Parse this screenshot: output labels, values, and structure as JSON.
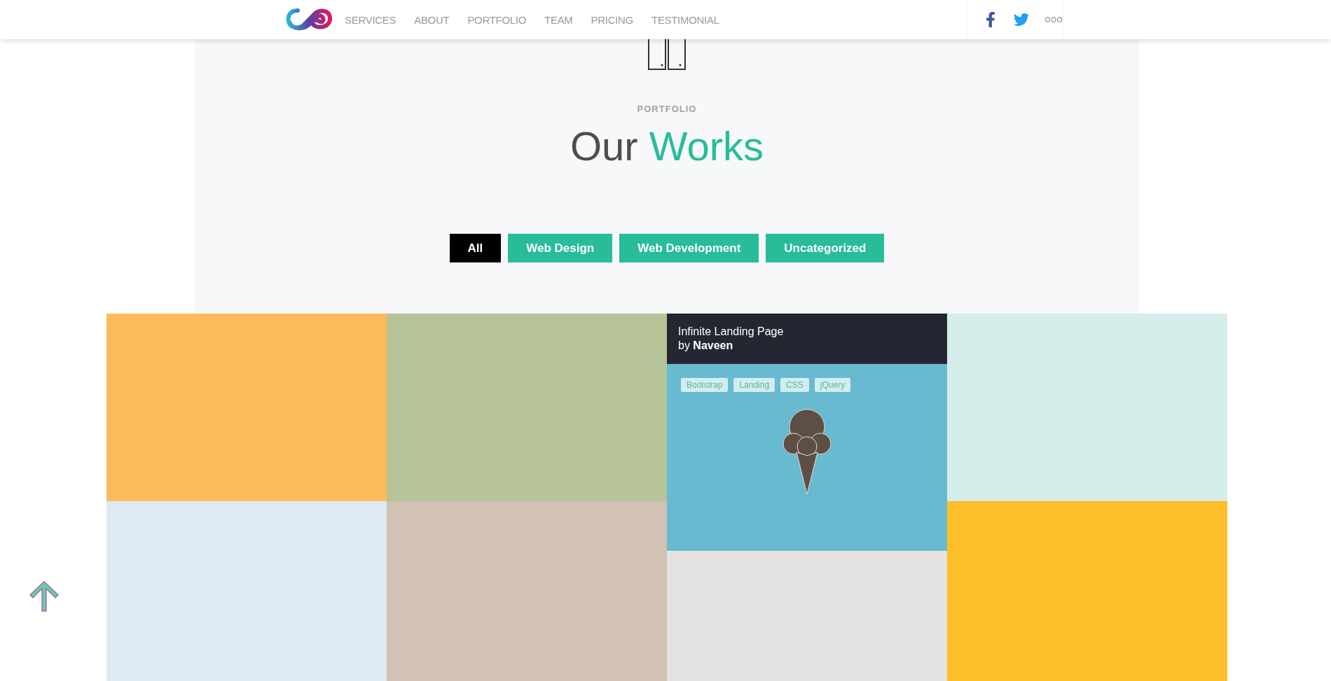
{
  "nav": {
    "items": [
      {
        "label": "SERVICES"
      },
      {
        "label": "ABOUT"
      },
      {
        "label": "PORTFOLIO"
      },
      {
        "label": "TEAM"
      },
      {
        "label": "PRICING"
      },
      {
        "label": "TESTIMONIAL"
      }
    ]
  },
  "section": {
    "eyebrow": "PORTFOLIO",
    "title_main": "Our",
    "title_accent": "Works"
  },
  "filters": [
    {
      "label": "All",
      "selected": true
    },
    {
      "label": "Web Design",
      "selected": false
    },
    {
      "label": "Web Development",
      "selected": false
    },
    {
      "label": "Uncategorized",
      "selected": false
    }
  ],
  "columns": [
    {
      "tiles": [
        {
          "kind": "blank",
          "color": "#fbbb5b"
        },
        {
          "kind": "blank",
          "color": "#dfe9f2"
        }
      ]
    },
    {
      "tiles": [
        {
          "kind": "blank",
          "color": "#b7c398"
        },
        {
          "kind": "blank",
          "color": "#d1c2b3"
        }
      ]
    },
    {
      "tiles": [
        {
          "kind": "project",
          "color": "#67bad0",
          "title": "Infinite Landing Page",
          "byline": "by **Naveen**",
          "tags": [
            "Bootstrap",
            "Landing",
            "CSS",
            "jQuery"
          ]
        },
        {
          "kind": "blank",
          "color": "#e4e3e1"
        }
      ]
    },
    {
      "tiles": [
        {
          "kind": "blank",
          "color": "#d6eeeb"
        },
        {
          "kind": "blank",
          "color": "#fcbf29"
        }
      ]
    }
  ]
}
